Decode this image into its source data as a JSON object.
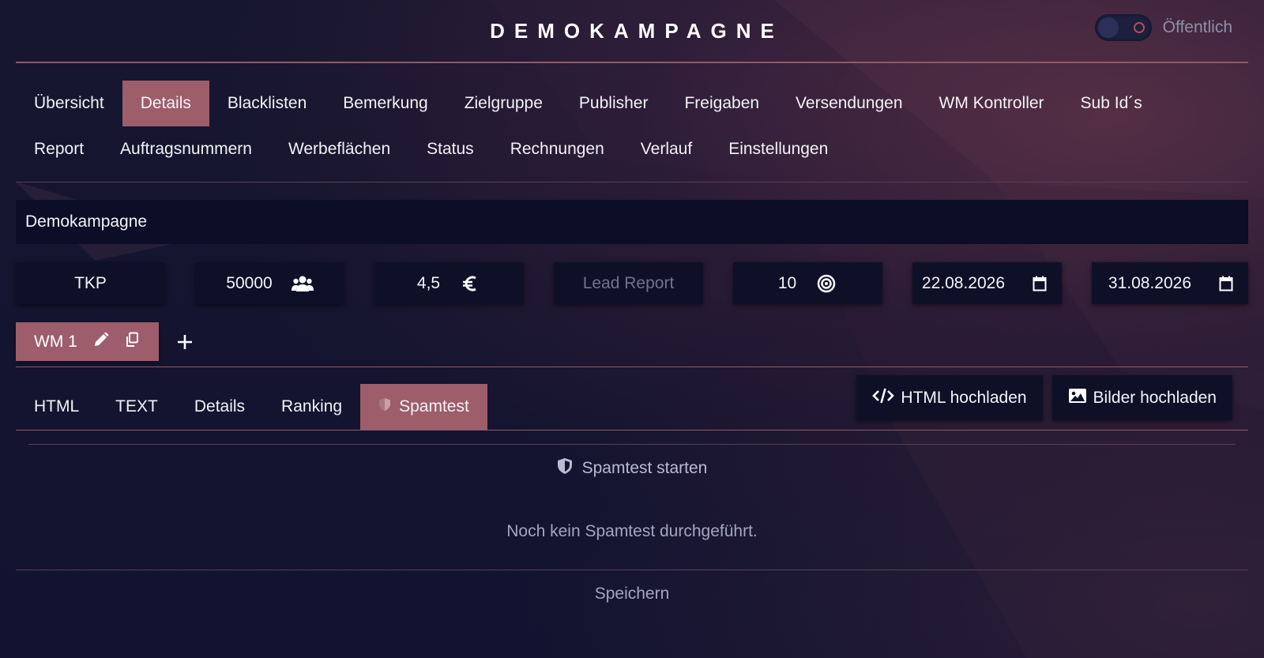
{
  "header": {
    "title": "DEMOKAMPAGNE",
    "public_toggle": {
      "label": "Öffentlich",
      "enabled": false
    }
  },
  "nav": {
    "row1": [
      "Übersicht",
      "Details",
      "Blacklisten",
      "Bemerkung",
      "Zielgruppe",
      "Publisher",
      "Freigaben",
      "Versendungen",
      "WM Kontroller",
      "Sub Id´s"
    ],
    "row2": [
      "Report",
      "Auftragsnummern",
      "Werbeflächen",
      "Status",
      "Rechnungen",
      "Verlauf",
      "Einstellungen"
    ],
    "active": "Details"
  },
  "campaign": {
    "name": "Demokampagne"
  },
  "fields": {
    "billing_model": "TKP",
    "volume": "50000",
    "price": "4,5",
    "report_type_placeholder": "Lead Report",
    "target": "10",
    "start_date": "22.08.2026",
    "end_date": "31.08.2026"
  },
  "wm": {
    "tab_label": "WM 1"
  },
  "sub_tabs": {
    "items": [
      "HTML",
      "TEXT",
      "Details",
      "Ranking",
      "Spamtest"
    ],
    "active": "Spamtest"
  },
  "buttons": {
    "html_upload": "HTML hochladen",
    "image_upload": "Bilder hochladen",
    "save": "Speichern"
  },
  "spamtest": {
    "start_label": "Spamtest starten",
    "empty_message": "Noch kein Spamtest durchgeführt."
  },
  "colors": {
    "background": "#12132c",
    "accent": "#9d5d6a",
    "field_bg": "#0e1028",
    "divider": "#8e5a66"
  }
}
